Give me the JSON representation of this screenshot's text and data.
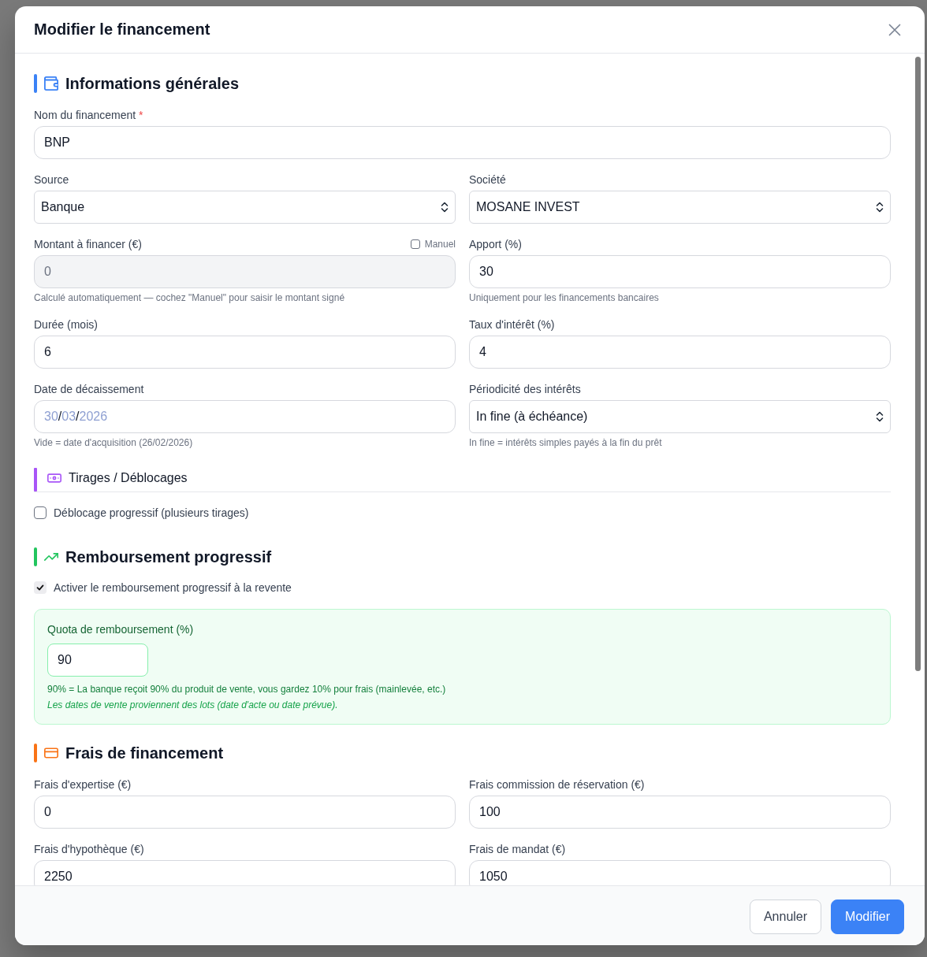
{
  "dialog": {
    "title": "Modifier le financement"
  },
  "general": {
    "title": "Informations générales",
    "name_field": {
      "label": "Nom du financement",
      "required_mark": "*",
      "value": "BNP"
    },
    "fields": [
      {
        "kind": "select",
        "label": "Source",
        "value": "Banque",
        "disabled": false
      },
      {
        "kind": "select",
        "label": "Société",
        "value": "MOSANE INVEST",
        "disabled": false
      },
      {
        "kind": "input",
        "label": "Montant à financer (€)",
        "value": "0",
        "disabled": true,
        "toggle": {
          "label": "Manuel",
          "checked": false
        },
        "hint": "Calculé automatiquement — cochez \"Manuel\" pour saisir le montant signé"
      },
      {
        "kind": "input",
        "label": "Apport (%)",
        "value": "30",
        "disabled": false,
        "hint": "Uniquement pour les financements bancaires"
      },
      {
        "kind": "input",
        "label": "Durée (mois)",
        "value": "6",
        "disabled": false
      },
      {
        "kind": "input",
        "label": "Taux d'intérêt (%)",
        "value": "4",
        "disabled": false
      },
      {
        "kind": "date",
        "label": "Date de décaissement",
        "placeholder": "30/03/2026",
        "disabled": false,
        "hint": "Vide = date d'acquisition (26/02/2026)"
      },
      {
        "kind": "select",
        "label": "Périodicité des intérêts",
        "value": "In fine (à échéance)",
        "disabled": false,
        "hint": "In fine = intérêts simples payés à la fin du prêt"
      }
    ]
  },
  "drawdowns": {
    "title": "Tirages / Déblocages",
    "checkbox": {
      "label": "Déblocage progressif (plusieurs tirages)",
      "checked": false
    }
  },
  "progressive_repayment": {
    "title": "Remboursement progressif",
    "checkbox": {
      "label": "Activer le remboursement progressif à la revente",
      "checked": true
    },
    "quota": {
      "label": "Quota de remboursement (%)",
      "value": "90",
      "hint": "90% = La banque reçoit 90% du produit de vente, vous gardez 10% pour frais (mainlevée, etc.)",
      "note": "Les dates de vente proviennent des lots (date d'acte ou date prévue)."
    }
  },
  "fees": {
    "title": "Frais de financement",
    "fields": [
      {
        "label": "Frais d'expertise (€)",
        "value": "0"
      },
      {
        "label": "Frais commission de réservation (€)",
        "value": "100"
      },
      {
        "label": "Frais d'hypothèque (€)",
        "value": "2250"
      },
      {
        "label": "Frais de mandat (€)",
        "value": "1050"
      }
    ]
  },
  "footer": {
    "buttons": [
      {
        "kind": "secondary",
        "label": "Annuler"
      },
      {
        "kind": "primary",
        "label": "Modifier"
      }
    ]
  }
}
